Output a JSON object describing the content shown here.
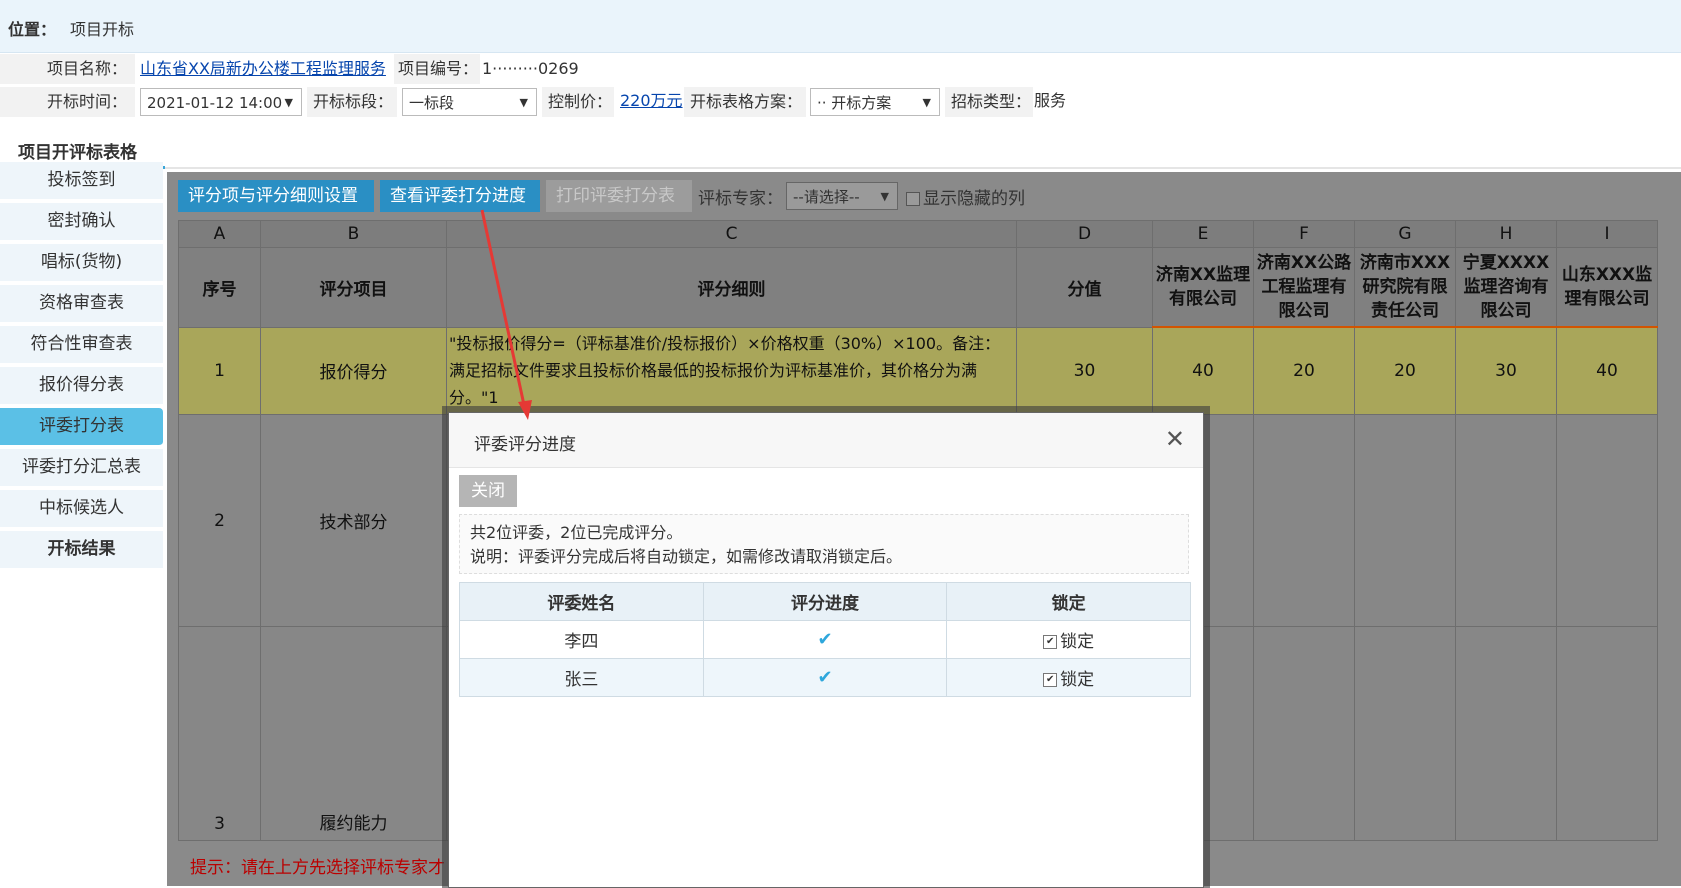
{
  "breadcrumb": {
    "label": "位置：",
    "value": "项目开标"
  },
  "info": {
    "project_name_label": "项目名称：",
    "project_name": "山东省XX局新办公楼工程监理服务",
    "project_code_label": "项目编号：",
    "project_code": "1·········0269",
    "open_time_label": "开标时间：",
    "open_time": "2021-01-12 14:00",
    "section_label": "开标标段：",
    "section": "一标段",
    "control_price_label": "控制价：",
    "control_price": "220万元",
    "scheme_label": "开标表格方案：",
    "scheme": "·· 开标方案",
    "bid_type_label": "招标类型：",
    "bid_type": "服务"
  },
  "section_title": "项目开评标表格",
  "sidebar": {
    "items": [
      {
        "label": "投标签到"
      },
      {
        "label": "密封确认"
      },
      {
        "label": "唱标(货物)"
      },
      {
        "label": "资格审查表"
      },
      {
        "label": "符合性审查表"
      },
      {
        "label": "报价得分表"
      },
      {
        "label": "评委打分表"
      },
      {
        "label": "评委打分汇总表"
      },
      {
        "label": "中标候选人"
      },
      {
        "label": "开标结果"
      }
    ]
  },
  "toolbar": {
    "btn_settings": "评分项与评分细则设置",
    "btn_progress": "查看评委打分进度",
    "btn_print": "打印评委打分表",
    "expert_label": "评标专家：",
    "expert_select": "--请选择--",
    "show_hidden": "显示隐藏的列"
  },
  "table": {
    "letters": [
      "A",
      "B",
      "C",
      "D",
      "E",
      "F",
      "G",
      "H",
      "I"
    ],
    "headers": [
      "序号",
      "评分项目",
      "评分细则",
      "分值"
    ],
    "companies": [
      "济南XX监理有限公司",
      "济南XX公路工程监理有限公司",
      "济南市XXX研究院有限责任公司",
      "宁夏XXXX监理咨询有限公司",
      "山东XXX监理有限公司"
    ],
    "row1": {
      "no": "1",
      "item": "报价得分",
      "desc": "\"投标报价得分=（评标基准价/投标报价）×价格权重（30%）×100。备注：满足招标文件要求且投标价格最低的投标报价为评标基准价，其价格分为满分。\"1",
      "score": "30",
      "values": [
        "40",
        "20",
        "20",
        "30",
        "40"
      ]
    },
    "row2": {
      "no": "2",
      "item": "技术部分"
    },
    "row3": {
      "no": "3",
      "item": "履约能力"
    }
  },
  "hint": "提示：请在上方先选择评标专家才",
  "dialog": {
    "title": "评委评分进度",
    "close_btn": "关闭",
    "summary": "共2位评委，2位已完成评分。",
    "note": "说明：评委评分完成后将自动锁定，如需修改请取消锁定后。",
    "columns": [
      "评委姓名",
      "评分进度",
      "锁定"
    ],
    "rows": [
      {
        "name": "李四",
        "lock": "锁定"
      },
      {
        "name": "张三",
        "lock": "锁定"
      }
    ]
  },
  "colors": {
    "accent": "#2a8fc4",
    "active_sidebar": "#5bc0e6",
    "highlight_row": "#a9a65a",
    "arrow": "#e53935"
  }
}
